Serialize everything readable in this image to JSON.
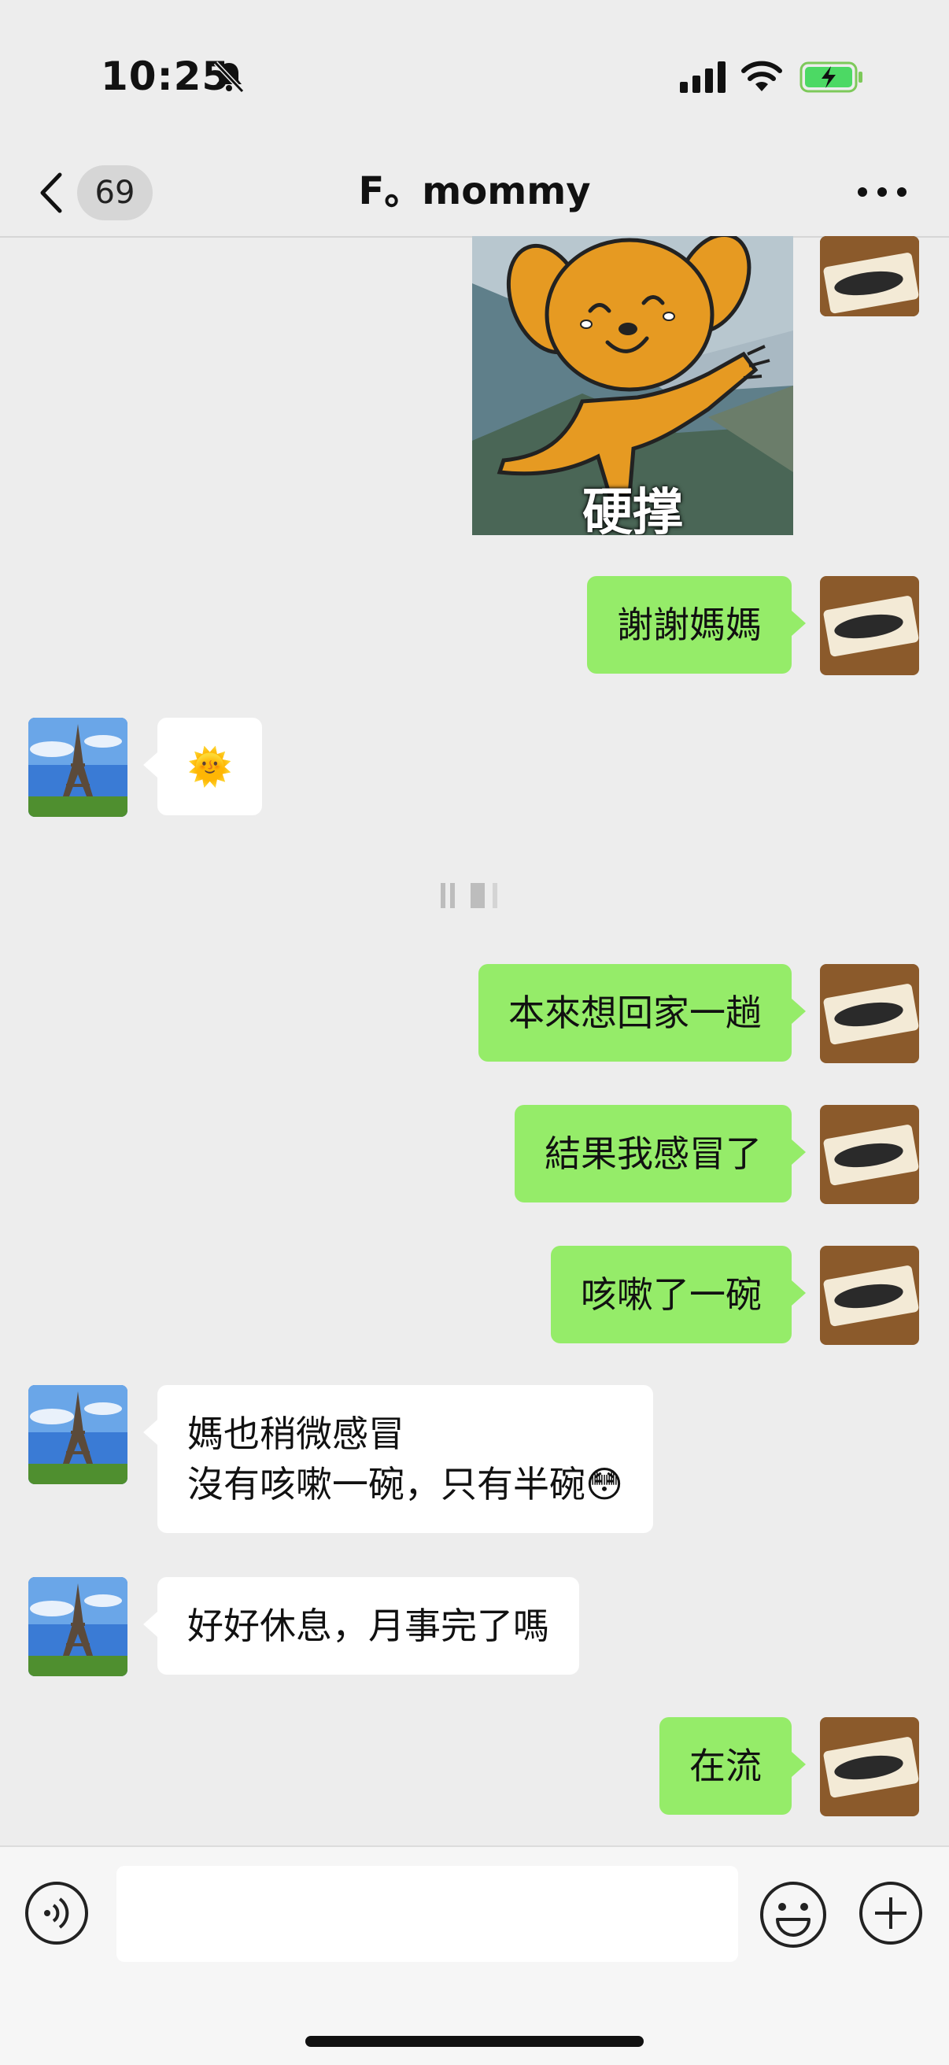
{
  "status_bar": {
    "time": "10:25"
  },
  "nav": {
    "unread_count": "69",
    "title": "F。mommy"
  },
  "messages": [
    {
      "sender": "me",
      "type": "sticker",
      "caption": "硬撑"
    },
    {
      "sender": "me",
      "type": "text",
      "text": "謝謝媽媽"
    },
    {
      "sender": "mom",
      "type": "emoji",
      "text": "🌞"
    },
    {
      "sender": "me",
      "type": "text",
      "text": "本來想回家一趟"
    },
    {
      "sender": "me",
      "type": "text",
      "text": "結果我感冒了"
    },
    {
      "sender": "me",
      "type": "text",
      "text": "咳嗽了一碗"
    },
    {
      "sender": "mom",
      "type": "text",
      "text": "媽也稍微感冒\n沒有咳嗽一碗，只有半碗😳"
    },
    {
      "sender": "mom",
      "type": "text",
      "text": "好好休息，月事完了嗎"
    },
    {
      "sender": "me",
      "type": "text",
      "text": "在流"
    }
  ],
  "input": {
    "placeholder": ""
  }
}
